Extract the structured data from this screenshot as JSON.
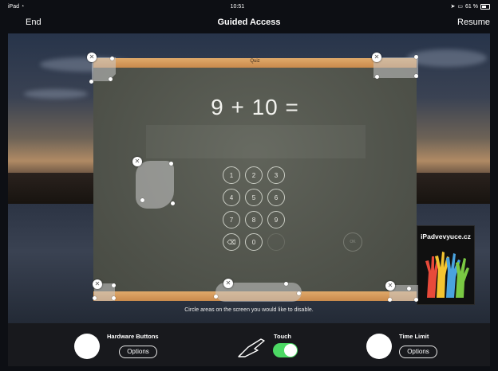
{
  "status_bar": {
    "device": "iPad",
    "time": "10:51",
    "battery": "61 %"
  },
  "nav": {
    "left_button": "End",
    "title": "Guided Access",
    "right_button": "Resume"
  },
  "app": {
    "title": "Quiz",
    "equation": "9 + 10 =",
    "keypad_keys": [
      "1",
      "2",
      "3",
      "4",
      "5",
      "6",
      "7",
      "8",
      "9",
      "⌫",
      "0"
    ],
    "ok_label": "OK"
  },
  "side_logo": {
    "text": "iPadvevyuce.cz"
  },
  "instruction": "Circle areas on the screen you would like to disable.",
  "controls": {
    "hardware_buttons": {
      "label": "Hardware Buttons",
      "options": "Options"
    },
    "touch": {
      "label": "Touch",
      "enabled": true
    },
    "time_limit": {
      "label": "Time Limit",
      "options": "Options"
    }
  },
  "colors": {
    "toggle_on": "#4cd964",
    "wood": "#d99b5a",
    "chalkboard": "#53564d"
  }
}
